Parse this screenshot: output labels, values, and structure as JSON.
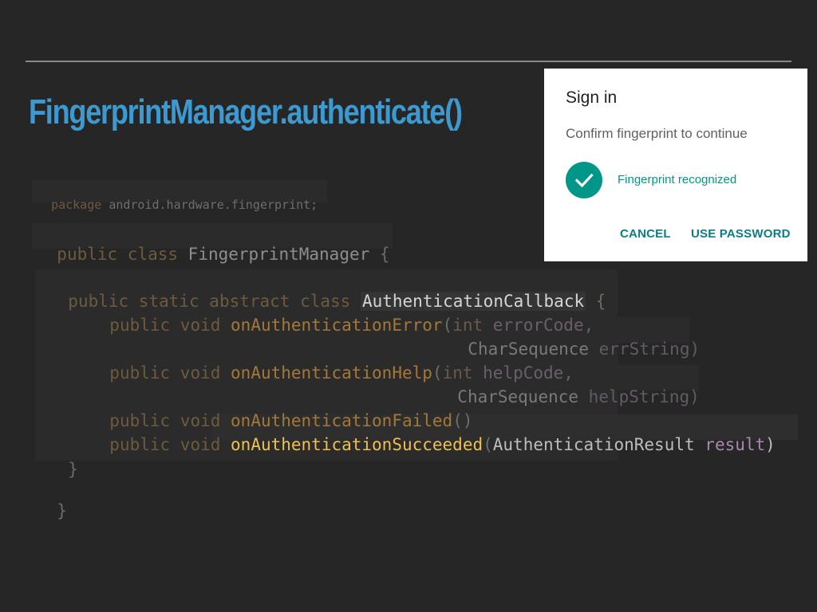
{
  "slide": {
    "title": "FingerprintManager.authenticate()"
  },
  "code": {
    "package_kw": "package",
    "package_name": "android.hardware.fingerprint;",
    "class_decl_kw": "public class",
    "class_name": "FingerprintManager",
    "open_brace": "{",
    "inner_kw": "public static abstract class",
    "inner_name": "AuthenticationCallback",
    "method_kw": "public void",
    "m1_name": "onAuthenticationError",
    "m1_open": "(",
    "m1_ptype": "int",
    "m1_pname": "errorCode,",
    "m1_ptype2": "CharSequence",
    "m1_pname2": "errString)",
    "m2_name": "onAuthenticationHelp",
    "m2_open": "(",
    "m2_ptype": "int",
    "m2_pname": "helpCode,",
    "m2_ptype2": "CharSequence",
    "m2_pname2": "helpString)",
    "m3_name": "onAuthenticationFailed",
    "m3_parens": "()",
    "m4_name": "onAuthenticationSucceeded",
    "m4_open": "(",
    "m4_ptype": "AuthenticationResult",
    "m4_pname": "result",
    "m4_close": ")",
    "close_brace": "}"
  },
  "dialog": {
    "title": "Sign in",
    "subtitle": "Confirm fingerprint to continue",
    "status": "Fingerprint recognized",
    "status_icon": "checkmark-icon",
    "cancel_label": "CANCEL",
    "use_password_label": "USE PASSWORD",
    "accent_color": "#009688"
  }
}
